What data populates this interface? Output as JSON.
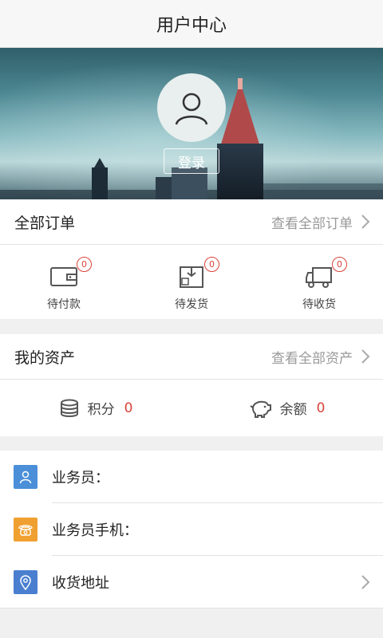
{
  "header": {
    "title": "用户中心"
  },
  "profile": {
    "login_label": "登录"
  },
  "orders": {
    "title": "全部订单",
    "link": "查看全部订单",
    "items": [
      {
        "label": "待付款",
        "count": "0",
        "icon": "wallet-icon"
      },
      {
        "label": "待发货",
        "count": "0",
        "icon": "package-icon"
      },
      {
        "label": "待收货",
        "count": "0",
        "icon": "truck-icon"
      }
    ]
  },
  "assets": {
    "title": "我的资产",
    "link": "查看全部资产",
    "items": [
      {
        "label": "积分",
        "value": "0",
        "icon": "coins-icon"
      },
      {
        "label": "余额",
        "value": "0",
        "icon": "piggy-bank-icon"
      }
    ]
  },
  "info": {
    "items": [
      {
        "label": "业务员：",
        "icon": "person-icon",
        "color": "#4a8fd8"
      },
      {
        "label": "业务员手机：",
        "icon": "phone-icon",
        "color": "#f0a030"
      },
      {
        "label": "收货地址",
        "icon": "location-pin-icon",
        "color": "#4a7fd0"
      }
    ]
  },
  "colors": {
    "accent_red": "#d9433b",
    "muted_text": "#999999"
  }
}
